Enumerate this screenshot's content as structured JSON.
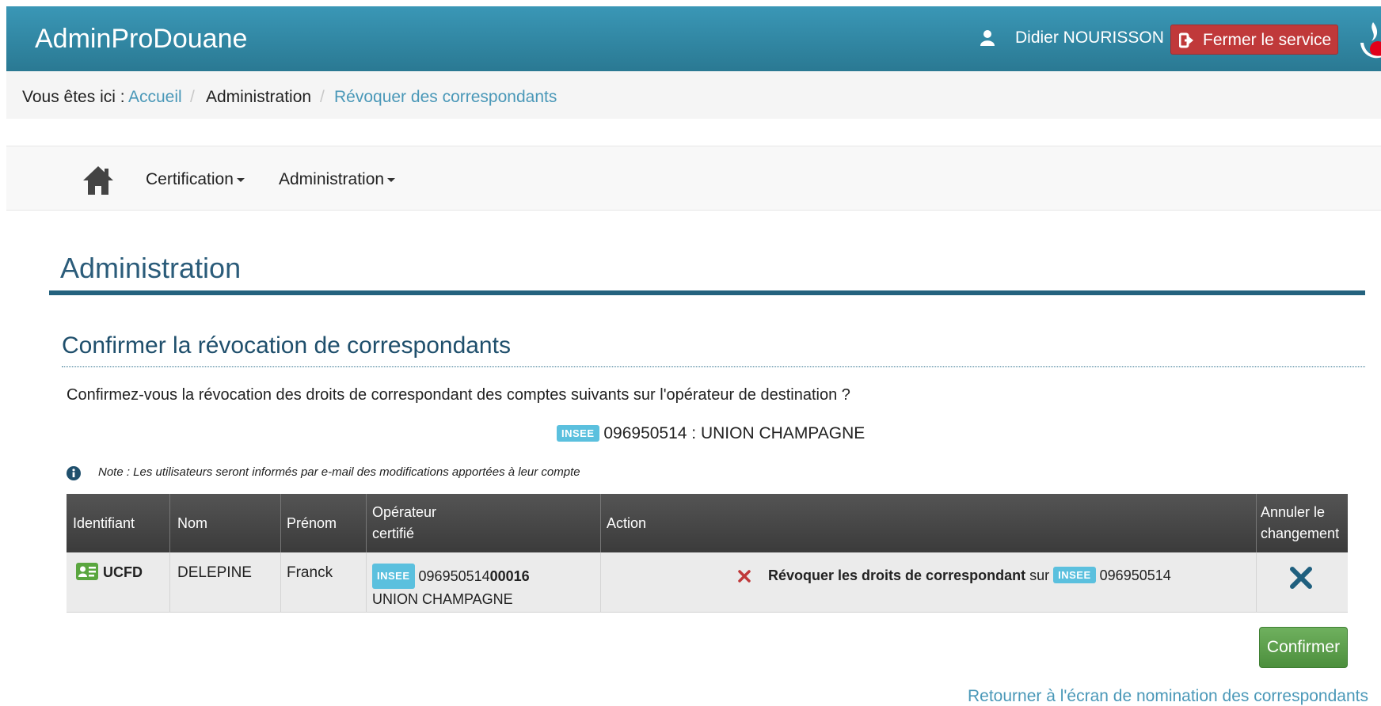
{
  "header": {
    "app_title": "AdminProDouane",
    "user_name": "Didier NOURISSON",
    "close_label": "Fermer le service"
  },
  "breadcrumb": {
    "prefix": "Vous êtes ici :",
    "items": [
      "Accueil",
      "Administration",
      "Révoquer des correspondants"
    ]
  },
  "nav": {
    "items": [
      "Certification",
      "Administration"
    ]
  },
  "page": {
    "title": "Administration",
    "section_title": "Confirmer la révocation de correspondants",
    "question": "Confirmez-vous la révocation des droits de correspondant des comptes suivants sur l'opérateur de destination ?",
    "target_badge": "INSEE",
    "target_operator": "096950514 : UNION CHAMPAGNE",
    "note": "Note : Les utilisateurs seront informés par e-mail des modifications apportées à leur compte"
  },
  "table": {
    "headers": [
      "Identifiant",
      "Nom",
      "Prénom",
      "Opérateur certifié",
      "Action",
      "Annuler le changement"
    ],
    "rows": [
      {
        "identifiant": "UCFD",
        "nom": "DELEPINE",
        "prenom": "Franck",
        "operateur_badge": "INSEE",
        "operateur_code_main": "096950514",
        "operateur_code_suffix": "00016",
        "operateur_name": "UNION CHAMPAGNE",
        "action_bold": "Révoquer les droits de correspondant",
        "action_sur": "sur",
        "action_badge": "INSEE",
        "action_code": "096950514"
      }
    ]
  },
  "buttons": {
    "confirm": "Confirmer",
    "back_link": "Retourner à l'écran de nomination des correspondants"
  },
  "colors": {
    "header_bg": "#2f86a4",
    "danger": "#c0393a",
    "success": "#5a9e4a",
    "link": "#4a98b8",
    "info_badge": "#5bc0de"
  }
}
